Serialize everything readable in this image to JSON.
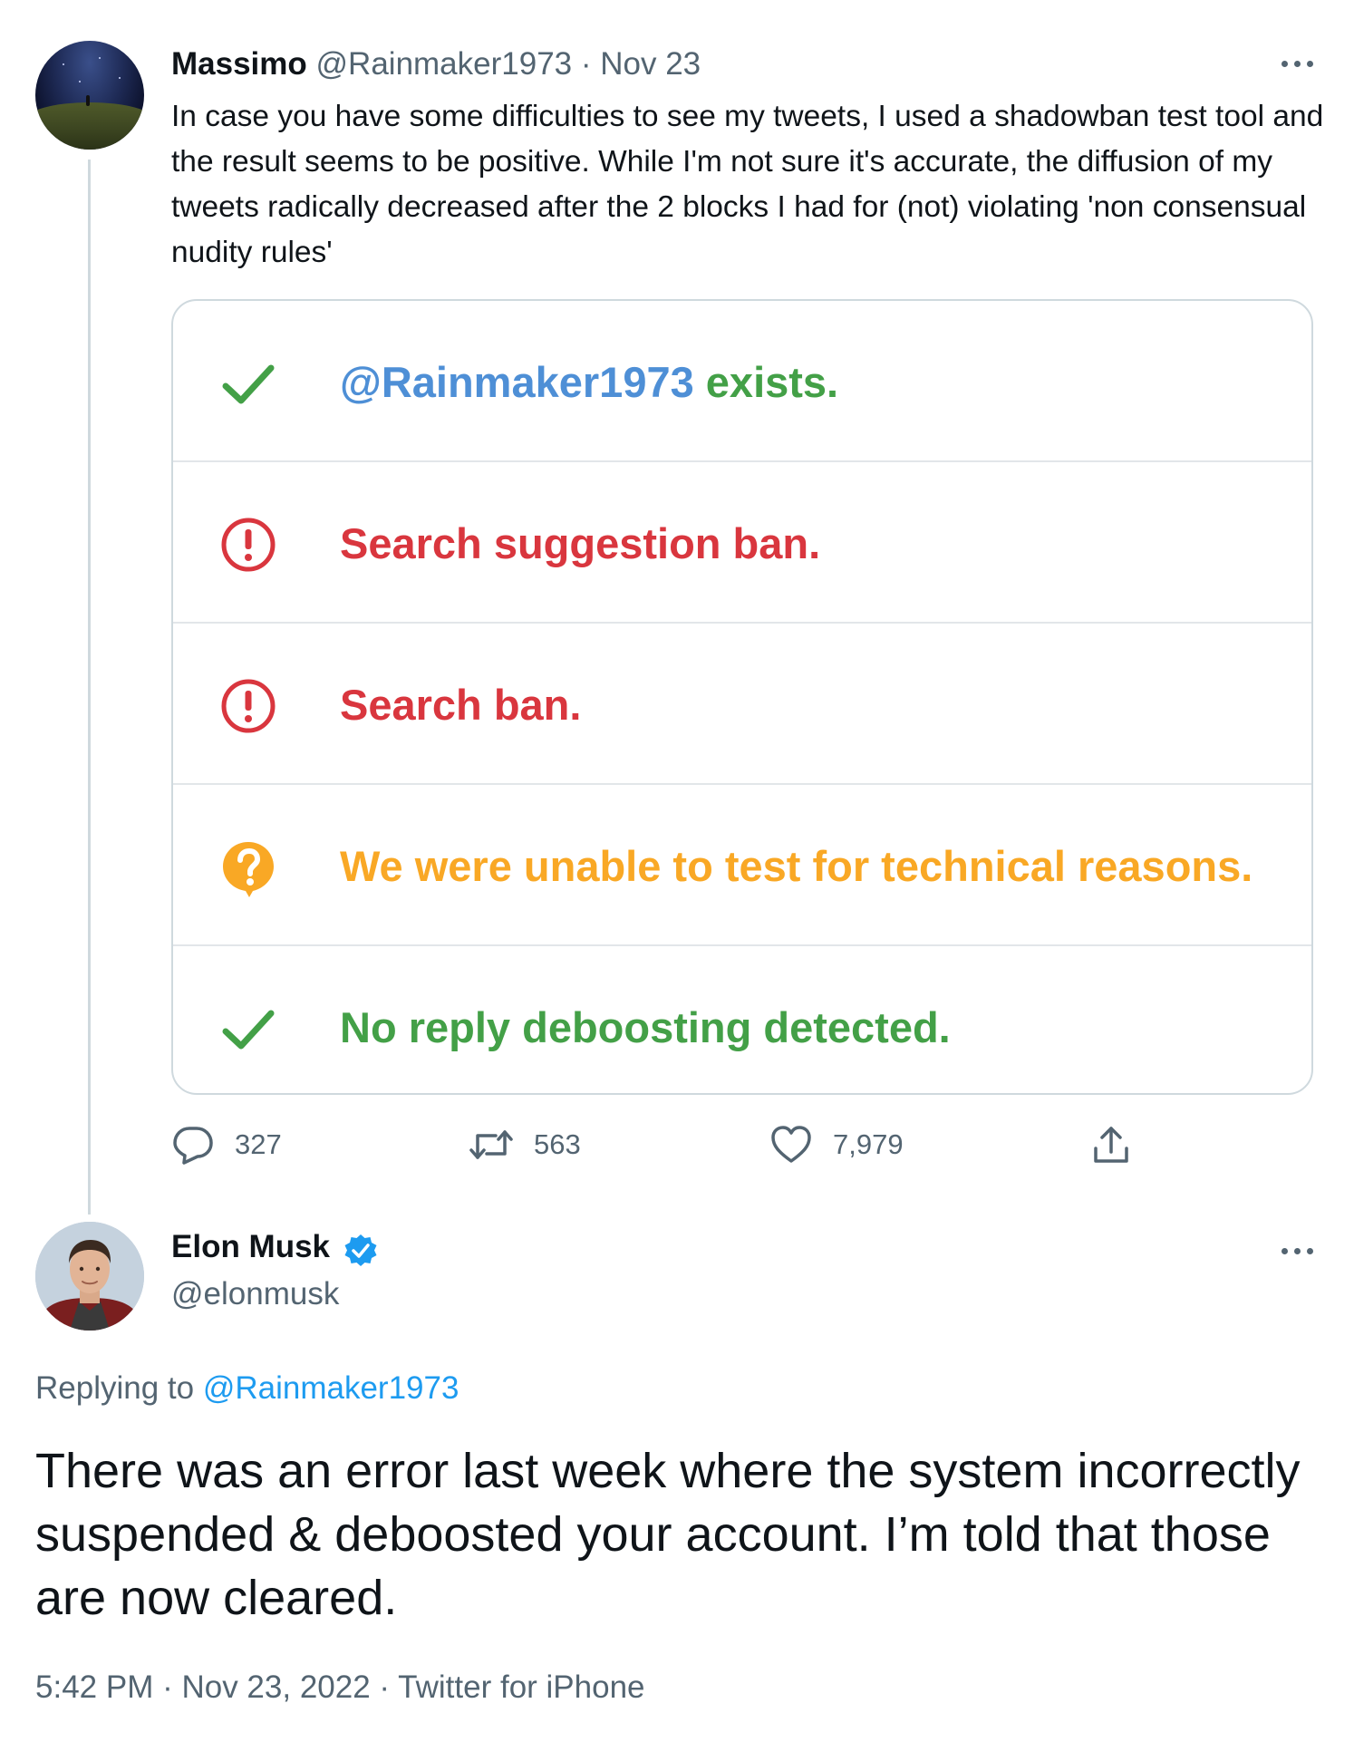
{
  "parent_tweet": {
    "name": "Massimo",
    "handle": "@Rainmaker1973",
    "separator": " · ",
    "date": "Nov 23",
    "text": "In case you have some difficulties to see my tweets, I used a shadowban test tool and the result seems to be positive. While I'm not sure it's accurate, the diffusion of my tweets radically decreased after the 2 blocks I had for (not) violating 'non consensual nudity rules'",
    "media": {
      "rows": [
        {
          "icon": "check-icon",
          "handle": "@Rainmaker1973",
          "text": " exists.",
          "color": "#43a047"
        },
        {
          "icon": "exclamation-circle-icon",
          "text": "Search suggestion ban.",
          "color": "#d9363e"
        },
        {
          "icon": "exclamation-circle-icon",
          "text": "Search ban.",
          "color": "#d9363e"
        },
        {
          "icon": "question-bubble-icon",
          "text": "We were unable to test for technical reasons.",
          "color": "#f9a825"
        },
        {
          "icon": "check-icon",
          "text": "No reply deboosting detected.",
          "color": "#43a047"
        }
      ]
    },
    "actions": {
      "replies": "327",
      "retweets": "563",
      "likes": "7,979"
    }
  },
  "main_tweet": {
    "name": "Elon Musk",
    "handle": "@elonmusk",
    "replying_prefix": "Replying to ",
    "replying_to": "@Rainmaker1973",
    "text": "There was an error last week where the system incorrectly suspended & deboosted your account. I’m told that those are now cleared.",
    "time": "5:42 PM",
    "sep1": " · ",
    "date": "Nov 23, 2022",
    "sep2": " · ",
    "source": "Twitter for iPhone"
  },
  "colors": {
    "text": "#0f1419",
    "muted": "#536471",
    "link": "#1d9bf0",
    "border": "#cfd9de"
  }
}
